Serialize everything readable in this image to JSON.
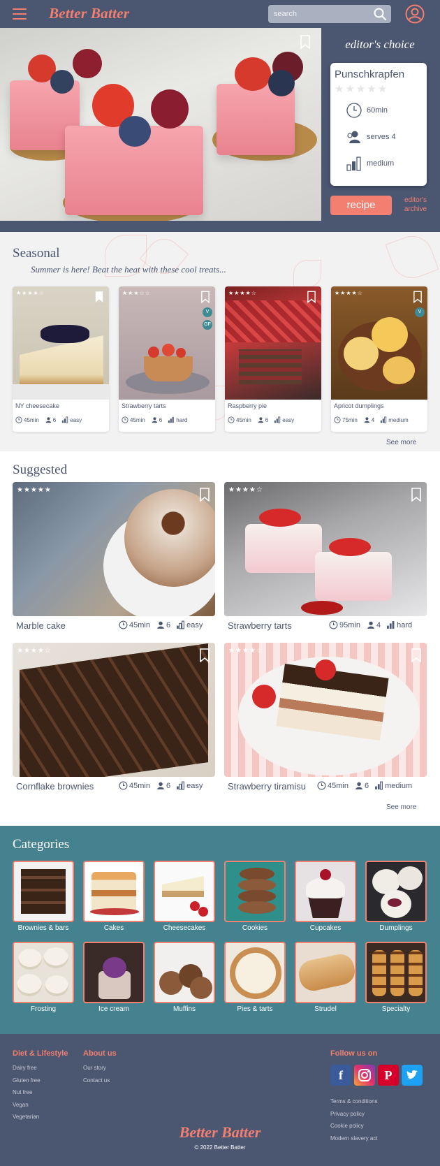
{
  "header": {
    "logo": "Better Batter",
    "search_placeholder": "search"
  },
  "hero": {
    "editors_choice": "editor's choice",
    "recipe_title": "Punschkrapfen",
    "rating": 0,
    "time": "60min",
    "serves": "serves 4",
    "difficulty": "medium",
    "recipe_button": "recipe",
    "archive_line1": "editor's",
    "archive_line2": "archive"
  },
  "seasonal": {
    "title": "Seasonal",
    "subtitle": "Summer is here! Beat the heat with these cool treats...",
    "see_more": "See more",
    "cards": [
      {
        "name": "NY cheesecake",
        "stars": "★★★★☆",
        "time": "45min",
        "serves": "6",
        "difficulty": "easy",
        "badges": []
      },
      {
        "name": "Strawberry tarts",
        "stars": "★★★☆☆",
        "time": "45min",
        "serves": "6",
        "difficulty": "hard",
        "badges": [
          "V",
          "GF"
        ]
      },
      {
        "name": "Raspberry pie",
        "stars": "★★★★☆",
        "time": "45min",
        "serves": "6",
        "difficulty": "easy",
        "badges": []
      },
      {
        "name": "Apricot dumplings",
        "stars": "★★★★☆",
        "time": "75min",
        "serves": "4",
        "difficulty": "medium",
        "badges": [
          "V"
        ]
      }
    ]
  },
  "suggested": {
    "title": "Suggested",
    "see_more": "See more",
    "cards": [
      {
        "name": "Marble cake",
        "stars": "★★★★★",
        "time": "45min",
        "serves": "6",
        "difficulty": "easy"
      },
      {
        "name": "Strawberry tarts",
        "stars": "★★★★☆",
        "time": "95min",
        "serves": "4",
        "difficulty": "hard"
      },
      {
        "name": "Cornflake brownies",
        "stars": "★★★★☆",
        "time": "45min",
        "serves": "6",
        "difficulty": "easy"
      },
      {
        "name": "Strawberry tiramisu",
        "stars": "★★★★☆",
        "time": "45min",
        "serves": "6",
        "difficulty": "medium"
      }
    ]
  },
  "categories": {
    "title": "Categories",
    "items": [
      "Brownies & bars",
      "Cakes",
      "Cheesecakes",
      "Cookies",
      "Cupcakes",
      "Dumplings",
      "Frosting",
      "Ice cream",
      "Muffins",
      "Pies & tarts",
      "Strudel",
      "Specialty"
    ]
  },
  "footer": {
    "diet_title": "Diet & Lifestyle",
    "diet_links": [
      "Dairy free",
      "Gluten free",
      "Nut free",
      "Vegan",
      "Vegetarian"
    ],
    "about_title": "About us",
    "about_links": [
      "Our story",
      "Contact us"
    ],
    "follow_title": "Follow us on",
    "legal_links": [
      "Terms & conditions",
      "Privacy policy",
      "Cookie policy",
      "Modern slavery act"
    ],
    "logo": "Better Batter",
    "copyright": "© 2022 Better Batter"
  },
  "colors": {
    "navy": "#4b5671",
    "coral": "#f27f6f",
    "teal": "#45828f"
  }
}
